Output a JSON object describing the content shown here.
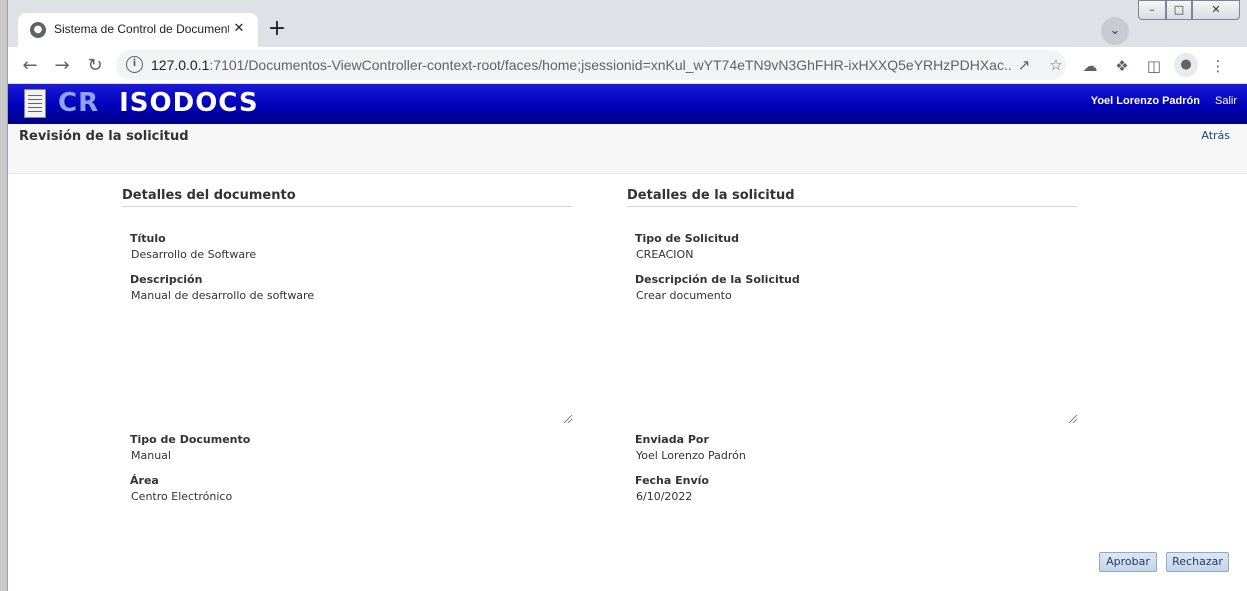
{
  "browser": {
    "tab_title": "Sistema de Control de Documentos",
    "url_host": "127.0.0.1",
    "url_rest": ":7101/Documentos-ViewController-context-root/faces/home;jsessionid=xnKul_wYT74eTN9vN3GhFHR-ixHXXQ5eYRHzPDHXac..."
  },
  "header": {
    "logo_cr": "CR",
    "logo_name": "ISODOCS",
    "user_name": "Yoel Lorenzo Padrón",
    "logout": "Salir"
  },
  "page": {
    "title": "Revisión de la solicitud",
    "back": "Atrás"
  },
  "documento": {
    "title": "Detalles del documento",
    "titulo_label": "Título",
    "titulo_value": "Desarrollo de Software",
    "descripcion_label": "Descripción",
    "descripcion_value": "Manual de desarrollo de software",
    "tipo_label": "Tipo de Documento",
    "tipo_value": "Manual",
    "area_label": "Área",
    "area_value": "Centro Electrónico"
  },
  "solicitud": {
    "title": "Detalles de la solicitud",
    "tipo_label": "Tipo de Solicitud",
    "tipo_value": "CREACION",
    "descripcion_label": "Descripción de la Solicitud",
    "descripcion_value": "Crear documento",
    "enviada_label": "Enviada Por",
    "enviada_value": "Yoel Lorenzo Padrón",
    "fecha_label": "Fecha Envío",
    "fecha_value": "6/10/2022"
  },
  "actions": {
    "approve": "Aprobar",
    "reject": "Rechazar"
  }
}
